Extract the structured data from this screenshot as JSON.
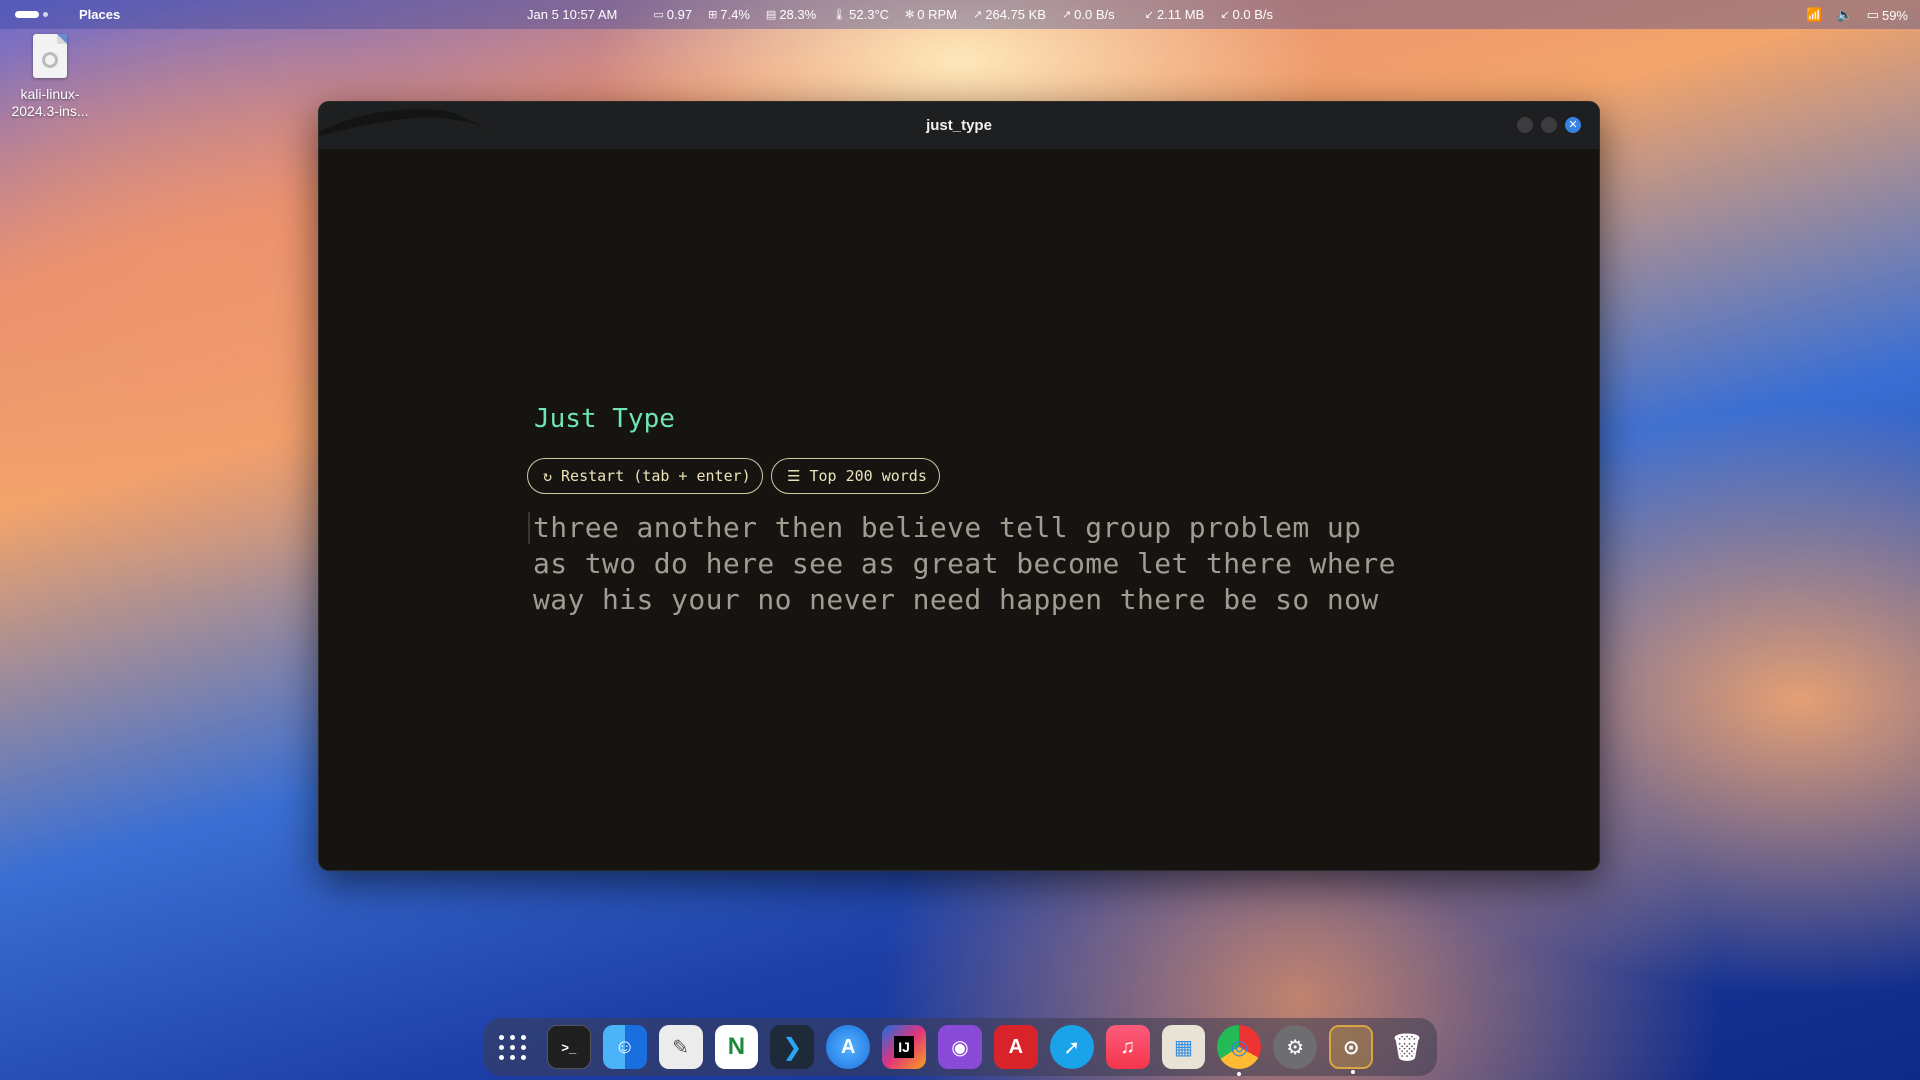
{
  "topbar": {
    "places": "Places",
    "datetime": "Jan 5  10:57 AM",
    "stats": [
      {
        "icon": "monitor-icon",
        "value": "0.97"
      },
      {
        "icon": "cpu-icon",
        "value": "7.4%"
      },
      {
        "icon": "memory-icon",
        "value": "28.3%"
      },
      {
        "icon": "thermometer-icon",
        "value": "52.3°C"
      },
      {
        "icon": "fan-icon",
        "value": "0 RPM"
      },
      {
        "icon": "upload-icon",
        "value": "264.75 KB"
      },
      {
        "icon": "upload-icon",
        "value": "0.0 B/s"
      },
      {
        "icon": "download-icon",
        "value": "2.11 MB"
      },
      {
        "icon": "download-icon",
        "value": "0.0 B/s"
      }
    ],
    "battery": "59%"
  },
  "desktop": {
    "file_label_line1": "kali-linux-",
    "file_label_line2": "2024.3-ins..."
  },
  "window": {
    "title": "just_type",
    "app_title": "Just Type",
    "restart_label": "Restart (tab + enter)",
    "words_label": "Top 200 words",
    "word_lines": [
      "three another then believe tell group problem up",
      "as two do here see as great become let there where",
      "way his your no never need happen there be so now"
    ]
  },
  "dock": {
    "items": [
      {
        "name": "app-grid",
        "color": "transparent"
      },
      {
        "name": "terminal",
        "color": "#1f1f1f",
        "glyph": ">_"
      },
      {
        "name": "finder",
        "color": "#2d8cf0",
        "glyph": "☺"
      },
      {
        "name": "text-editor",
        "color": "#e8e8e8",
        "glyph": "✎"
      },
      {
        "name": "notion",
        "color": "#ffffff",
        "glyph": "N"
      },
      {
        "name": "vscode",
        "color": "#1e2a3a",
        "glyph": "❯"
      },
      {
        "name": "app-store",
        "color": "#3a8dde",
        "glyph": "A"
      },
      {
        "name": "intellij",
        "color": "#e0337d",
        "glyph": "IJ"
      },
      {
        "name": "github-desktop",
        "color": "#8a4ad8",
        "glyph": "◉"
      },
      {
        "name": "acrobat",
        "color": "#d8232a",
        "glyph": "A"
      },
      {
        "name": "safari",
        "color": "#1aa3e8",
        "glyph": "➚"
      },
      {
        "name": "music",
        "color": "#f5364b",
        "glyph": "♫"
      },
      {
        "name": "launchpad",
        "color": "#e9e2d6",
        "glyph": "▦"
      },
      {
        "name": "chrome",
        "color": "#ffffff",
        "glyph": "◎"
      },
      {
        "name": "settings",
        "color": "#6d6d72",
        "glyph": "⚙"
      },
      {
        "name": "just-type",
        "color": "#d9a441",
        "glyph": "⊙"
      },
      {
        "name": "trash",
        "color": "#cfcfd2",
        "glyph": "🗑"
      }
    ]
  }
}
